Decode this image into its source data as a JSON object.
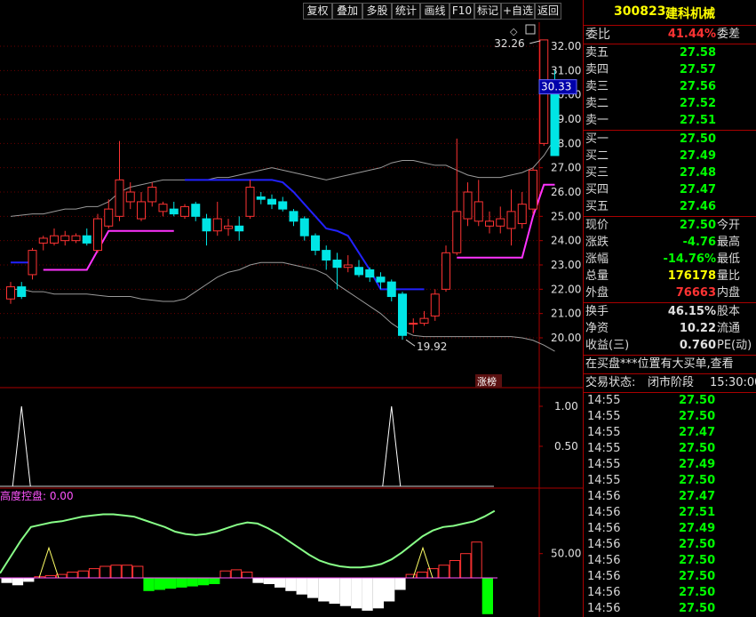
{
  "toolbar": {
    "buttons": [
      "复权",
      "叠加",
      "多股",
      "统计",
      "画线",
      "F10",
      "标记",
      "+自选",
      "返回"
    ]
  },
  "chart": {
    "price_axis": [
      "32.00",
      "31.00",
      "30.00",
      "29.00",
      "28.00",
      "27.00",
      "26.00",
      "25.00",
      "24.00",
      "23.00",
      "22.00",
      "21.00",
      "20.00"
    ],
    "current_price_tag": "30.33",
    "high_label": "32.26",
    "low_label": "19.92",
    "badge": "涨榜",
    "indicator_axis": [
      "1.00",
      "0.50"
    ],
    "bottom_title": "高度控盘: 0.00",
    "bottom_axis": "50.00",
    "colors": {
      "up": "#ff3333",
      "down": "#00e5e5",
      "boll": "#9a9a9a",
      "blue_line": "#2222ff",
      "magenta": "#ff33ff",
      "green_bar": "#00ff00",
      "curve": "#88ff88"
    }
  },
  "panel": {
    "stock_code": "300823",
    "stock_name": "建科机械",
    "weibi": {
      "label": "委比",
      "value": "41.44%",
      "label2": "委差"
    },
    "asks": [
      {
        "label": "卖五",
        "price": "27.58"
      },
      {
        "label": "卖四",
        "price": "27.57"
      },
      {
        "label": "卖三",
        "price": "27.56"
      },
      {
        "label": "卖二",
        "price": "27.52"
      },
      {
        "label": "卖一",
        "price": "27.51"
      }
    ],
    "bids": [
      {
        "label": "买一",
        "price": "27.50"
      },
      {
        "label": "买二",
        "price": "27.49"
      },
      {
        "label": "买三",
        "price": "27.48"
      },
      {
        "label": "买四",
        "price": "27.47"
      },
      {
        "label": "买五",
        "price": "27.46"
      }
    ],
    "quote": [
      {
        "label": "现价",
        "value": "27.50",
        "label2": "今开",
        "color": "#00ff00"
      },
      {
        "label": "涨跌",
        "value": "-4.76",
        "label2": "最高",
        "color": "#00ff00"
      },
      {
        "label": "涨幅",
        "value": "-14.76%",
        "label2": "最低",
        "color": "#00ff00"
      },
      {
        "label": "总量",
        "value": "176178",
        "label2": "量比",
        "color": "#ffff00"
      },
      {
        "label": "外盘",
        "value": "76663",
        "label2": "内盘",
        "color": "#ff3333"
      }
    ],
    "finance": [
      {
        "label": "换手",
        "value": "46.15%",
        "label2": "股本"
      },
      {
        "label": "净资",
        "value": "10.22",
        "label2": "流通"
      },
      {
        "label": "收益(三)",
        "value": "0.760",
        "label2": "PE(动)"
      }
    ],
    "notice": "在买盘***位置有大买单,查看",
    "status": {
      "label": "交易状态:",
      "value": "闭市阶段",
      "time": "15:30:00"
    },
    "ticks": [
      {
        "time": "14:55",
        "price": "27.50"
      },
      {
        "time": "14:55",
        "price": "27.50"
      },
      {
        "time": "14:55",
        "price": "27.47"
      },
      {
        "time": "14:55",
        "price": "27.50"
      },
      {
        "time": "14:55",
        "price": "27.49"
      },
      {
        "time": "14:55",
        "price": "27.50"
      },
      {
        "time": "14:56",
        "price": "27.47"
      },
      {
        "time": "14:56",
        "price": "27.51"
      },
      {
        "time": "14:56",
        "price": "27.49"
      },
      {
        "time": "14:56",
        "price": "27.50"
      },
      {
        "time": "14:56",
        "price": "27.50"
      },
      {
        "time": "14:56",
        "price": "27.50"
      },
      {
        "time": "14:56",
        "price": "27.50"
      },
      {
        "time": "14:56",
        "price": "27.50"
      }
    ]
  },
  "chart_data": {
    "type": "candlestick",
    "y_range": [
      19.5,
      32.5
    ],
    "candles": [
      {
        "o": 21.6,
        "c": 22.1,
        "h": 22.3,
        "l": 21.4
      },
      {
        "o": 22.1,
        "c": 21.7,
        "h": 22.3,
        "l": 21.6
      },
      {
        "o": 22.6,
        "c": 23.6,
        "h": 23.7,
        "l": 22.4
      },
      {
        "o": 23.9,
        "c": 24.1,
        "h": 24.2,
        "l": 23.6
      },
      {
        "o": 23.9,
        "c": 24.2,
        "h": 24.5,
        "l": 23.8
      },
      {
        "o": 24.0,
        "c": 24.2,
        "h": 24.4,
        "l": 23.8
      },
      {
        "o": 24.0,
        "c": 24.2,
        "h": 24.3,
        "l": 23.9
      },
      {
        "o": 24.2,
        "c": 23.9,
        "h": 24.5,
        "l": 23.8
      },
      {
        "o": 23.6,
        "c": 24.9,
        "h": 25.1,
        "l": 23.5
      },
      {
        "o": 24.6,
        "c": 25.3,
        "h": 25.7,
        "l": 24.5
      },
      {
        "o": 25.0,
        "c": 26.5,
        "h": 28.1,
        "l": 24.8
      },
      {
        "o": 25.6,
        "c": 26.0,
        "h": 26.4,
        "l": 25.3
      },
      {
        "o": 24.9,
        "c": 25.6,
        "h": 26.0,
        "l": 24.8
      },
      {
        "o": 25.6,
        "c": 26.2,
        "h": 26.4,
        "l": 25.4
      },
      {
        "o": 25.2,
        "c": 25.5,
        "h": 25.6,
        "l": 25.0
      },
      {
        "o": 25.3,
        "c": 25.1,
        "h": 25.6,
        "l": 25.0
      },
      {
        "o": 25.0,
        "c": 25.4,
        "h": 25.5,
        "l": 24.9
      },
      {
        "o": 25.5,
        "c": 25.0,
        "h": 25.6,
        "l": 24.8
      },
      {
        "o": 24.9,
        "c": 24.4,
        "h": 25.1,
        "l": 23.8
      },
      {
        "o": 24.4,
        "c": 24.9,
        "h": 25.6,
        "l": 24.2
      },
      {
        "o": 24.5,
        "c": 24.6,
        "h": 24.9,
        "l": 24.2
      },
      {
        "o": 24.6,
        "c": 24.4,
        "h": 25.0,
        "l": 24.0
      },
      {
        "o": 25.0,
        "c": 26.2,
        "h": 26.5,
        "l": 24.9
      },
      {
        "o": 25.8,
        "c": 25.7,
        "h": 26.0,
        "l": 25.5
      },
      {
        "o": 25.7,
        "c": 25.5,
        "h": 25.9,
        "l": 25.3
      },
      {
        "o": 25.6,
        "c": 25.3,
        "h": 25.8,
        "l": 25.2
      },
      {
        "o": 25.2,
        "c": 24.8,
        "h": 25.3,
        "l": 24.6
      },
      {
        "o": 24.9,
        "c": 24.2,
        "h": 25.0,
        "l": 24.0
      },
      {
        "o": 24.2,
        "c": 23.6,
        "h": 24.3,
        "l": 23.4
      },
      {
        "o": 23.6,
        "c": 23.2,
        "h": 23.8,
        "l": 22.8
      },
      {
        "o": 23.2,
        "c": 22.9,
        "h": 23.5,
        "l": 22.0
      },
      {
        "o": 22.9,
        "c": 23.0,
        "h": 23.4,
        "l": 22.7
      },
      {
        "o": 22.9,
        "c": 22.6,
        "h": 23.2,
        "l": 22.5
      },
      {
        "o": 22.8,
        "c": 22.5,
        "h": 22.9,
        "l": 22.3
      },
      {
        "o": 22.5,
        "c": 22.3,
        "h": 22.7,
        "l": 22.0
      },
      {
        "o": 22.3,
        "c": 21.7,
        "h": 22.4,
        "l": 21.5
      },
      {
        "o": 21.8,
        "c": 20.1,
        "h": 21.9,
        "l": 19.92
      },
      {
        "o": 20.6,
        "c": 20.6,
        "h": 20.8,
        "l": 20.2
      },
      {
        "o": 20.6,
        "c": 20.8,
        "h": 21.1,
        "l": 20.5
      },
      {
        "o": 20.9,
        "c": 21.8,
        "h": 22.0,
        "l": 20.7
      },
      {
        "o": 22.0,
        "c": 23.5,
        "h": 23.8,
        "l": 21.9
      },
      {
        "o": 23.5,
        "c": 25.2,
        "h": 28.2,
        "l": 23.4
      },
      {
        "o": 24.9,
        "c": 26.0,
        "h": 26.4,
        "l": 24.6
      },
      {
        "o": 24.8,
        "c": 25.6,
        "h": 26.5,
        "l": 24.6
      },
      {
        "o": 24.6,
        "c": 24.8,
        "h": 25.2,
        "l": 24.3
      },
      {
        "o": 24.6,
        "c": 24.9,
        "h": 25.4,
        "l": 24.3
      },
      {
        "o": 24.5,
        "c": 25.2,
        "h": 26.1,
        "l": 23.8
      },
      {
        "o": 24.7,
        "c": 25.5,
        "h": 26.0,
        "l": 24.5
      },
      {
        "o": 25.3,
        "c": 26.9,
        "h": 27.0,
        "l": 25.1
      },
      {
        "o": 28.0,
        "c": 32.26,
        "h": 32.26,
        "l": 27.9
      },
      {
        "o": 30.33,
        "c": 27.5,
        "h": 31.0,
        "l": 27.5
      }
    ],
    "boll_upper": [
      25.0,
      25.05,
      25.1,
      25.1,
      25.2,
      25.3,
      25.3,
      25.4,
      25.4,
      25.6,
      26.0,
      26.2,
      26.3,
      26.4,
      26.5,
      26.5,
      26.5,
      26.5,
      26.5,
      26.6,
      26.6,
      26.7,
      26.8,
      26.9,
      27.0,
      26.9,
      26.8,
      26.7,
      26.6,
      26.5,
      26.6,
      26.7,
      26.8,
      26.9,
      27.0,
      27.2,
      27.3,
      27.3,
      27.2,
      27.1,
      27.1,
      26.9,
      26.7,
      26.6,
      26.6,
      26.6,
      26.7,
      26.8,
      27.0,
      27.5,
      28.2
    ],
    "boll_lower": [
      22.0,
      22.0,
      21.9,
      21.9,
      21.8,
      21.8,
      21.8,
      21.8,
      21.75,
      21.7,
      21.7,
      21.7,
      21.6,
      21.55,
      21.5,
      21.5,
      21.6,
      21.9,
      22.2,
      22.5,
      22.7,
      22.8,
      23.0,
      23.1,
      23.1,
      23.1,
      23.0,
      22.9,
      22.8,
      22.6,
      22.2,
      21.9,
      21.6,
      21.3,
      21.0,
      20.6,
      20.3,
      20.1,
      20.05,
      20.05,
      20.05,
      20.05,
      20.05,
      20.05,
      20.05,
      20.05,
      20.05,
      20.0,
      19.9,
      19.7,
      19.45
    ],
    "blue_line": [
      23.1,
      23.1,
      23.1,
      null,
      null,
      null,
      null,
      null,
      null,
      null,
      null,
      null,
      null,
      null,
      null,
      null,
      26.5,
      26.5,
      26.5,
      26.5,
      26.5,
      26.5,
      26.5,
      26.5,
      26.5,
      26.4,
      26.0,
      25.5,
      25.0,
      24.5,
      24.4,
      24.2,
      23.5,
      22.8,
      22.0,
      22.0,
      22.0,
      22.0,
      22.0,
      null,
      null,
      null,
      null,
      null,
      null,
      null,
      null,
      null,
      null,
      null,
      null
    ],
    "magenta_line": [
      null,
      null,
      null,
      22.8,
      22.8,
      22.8,
      22.8,
      22.8,
      23.6,
      24.4,
      24.4,
      24.4,
      24.4,
      24.4,
      24.4,
      24.4,
      null,
      null,
      null,
      null,
      null,
      null,
      null,
      null,
      null,
      null,
      null,
      null,
      null,
      null,
      null,
      null,
      null,
      null,
      null,
      null,
      null,
      null,
      null,
      null,
      null,
      23.3,
      23.3,
      23.3,
      23.3,
      23.3,
      23.3,
      23.3,
      25.0,
      26.3,
      26.3
    ],
    "indicator_spikes": [
      1,
      35
    ],
    "indicator_range": [
      0,
      1.2
    ],
    "curve": [
      4,
      18,
      32,
      44,
      46,
      48,
      49,
      51,
      53,
      54,
      55,
      55,
      54,
      53,
      50,
      47,
      44,
      40,
      38,
      37,
      38,
      40,
      43,
      46,
      48,
      47,
      43,
      38,
      32,
      26,
      20,
      15,
      12,
      10,
      9,
      9,
      10,
      12,
      16,
      22,
      29,
      36,
      41,
      44,
      45,
      47,
      49,
      53,
      58
    ],
    "bars": [
      -4,
      -6,
      -3,
      1,
      2,
      3,
      5,
      6,
      8,
      10,
      11,
      11,
      10,
      -11,
      -10,
      -9,
      -8,
      -7,
      -6,
      -5,
      6,
      7,
      5,
      -4,
      -5,
      -8,
      -11,
      -14,
      -17,
      -20,
      -22,
      -24,
      -26,
      -28,
      -26,
      -20,
      -10,
      3,
      5,
      8,
      11,
      15,
      21,
      31,
      -31
    ],
    "bottom_range": [
      -40,
      70
    ]
  }
}
